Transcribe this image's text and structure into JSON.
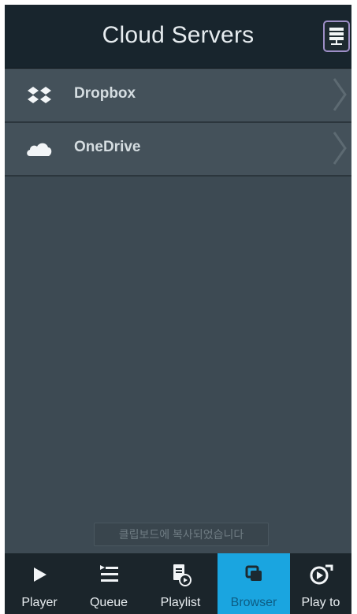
{
  "header": {
    "title": "Cloud Servers"
  },
  "servers": [
    {
      "label": "Dropbox",
      "icon": "dropbox-icon"
    },
    {
      "label": "OneDrive",
      "icon": "onedrive-cloud-icon"
    }
  ],
  "toast": {
    "text": "클립보드에 복사되었습니다"
  },
  "tabs": [
    {
      "label": "Player",
      "icon": "play-icon",
      "active": false
    },
    {
      "label": "Queue",
      "icon": "queue-list-icon",
      "active": false
    },
    {
      "label": "Playlist",
      "icon": "playlist-icon",
      "active": false
    },
    {
      "label": "Browser",
      "icon": "browser-icon",
      "active": true
    },
    {
      "label": "Play to",
      "icon": "play-to-icon",
      "active": false
    }
  ],
  "colors": {
    "active_tab": "#1aa5e0",
    "header_bg": "#18252d",
    "body_bg": "#3d4a53"
  }
}
